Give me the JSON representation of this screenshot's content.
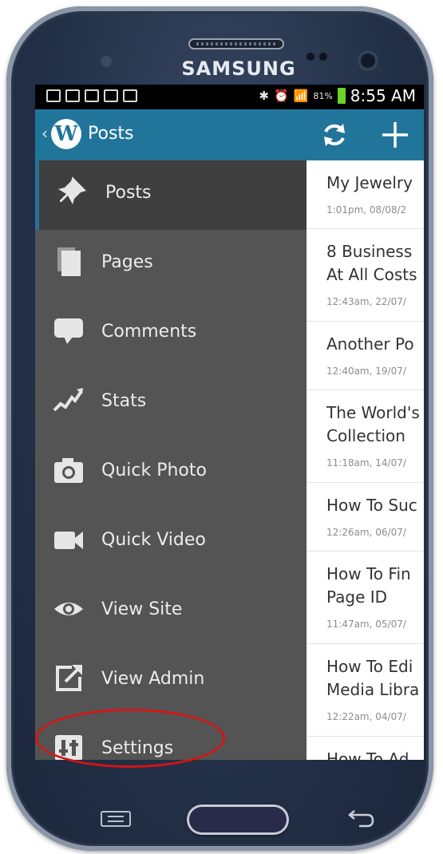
{
  "device": {
    "brand": "SAMSUNG"
  },
  "status_bar": {
    "time": "8:55 AM",
    "battery_percent": "81%"
  },
  "action_bar": {
    "back_glyph": "‹",
    "logo_letter": "W",
    "title": "Posts"
  },
  "drawer": {
    "items": [
      {
        "label": "Posts",
        "icon": "pin-icon",
        "active": true
      },
      {
        "label": "Pages",
        "icon": "pages-icon"
      },
      {
        "label": "Comments",
        "icon": "comment-icon"
      },
      {
        "label": "Stats",
        "icon": "stats-icon"
      },
      {
        "label": "Quick Photo",
        "icon": "camera-icon"
      },
      {
        "label": "Quick Video",
        "icon": "video-icon"
      },
      {
        "label": "View Site",
        "icon": "eye-icon"
      },
      {
        "label": "View Admin",
        "icon": "external-link-icon"
      },
      {
        "label": "Settings",
        "icon": "settings-icon"
      }
    ]
  },
  "posts": [
    {
      "title": "My Jewelry",
      "date": "1:01pm, 08/08/2"
    },
    {
      "title": "8 Business\nAt All Costs",
      "date": "12:43am, 22/07/"
    },
    {
      "title": "Another Po",
      "date": "12:40am, 19/07/"
    },
    {
      "title": "The World's\nCollection",
      "date": "11:18am, 14/07/"
    },
    {
      "title": "How To Suc",
      "date": "12:26am, 06/07/"
    },
    {
      "title": "How To Fin\nPage ID",
      "date": "11:47am, 05/07/"
    },
    {
      "title": "How To Edi\nMedia Libra",
      "date": "12:22am, 04/07/"
    },
    {
      "title": "How To Ad",
      "date": ""
    }
  ],
  "colors": {
    "action_bar": "#21759b",
    "drawer_bg": "#545454",
    "drawer_active": "#3f3f3f",
    "highlight": "#d51414"
  }
}
